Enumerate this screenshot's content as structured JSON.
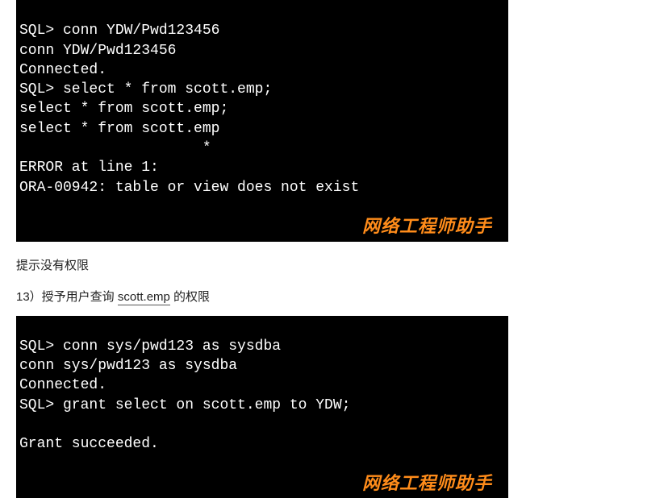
{
  "terminal1": {
    "l1": "SQL> conn YDW/Pwd123456",
    "l2": "conn YDW/Pwd123456",
    "l3": "Connected.",
    "l4": "SQL> select * from scott.emp;",
    "l5": "select * from scott.emp;",
    "l6": "select * from scott.emp",
    "l7": "                     *",
    "l8": "ERROR at line 1:",
    "l9": "ORA-00942: table or view does not exist",
    "watermark": "网络工程师助手"
  },
  "caption1": "提示没有权限",
  "step13_prefix": "13）授予用户查询 ",
  "step13_underlined": "scott.emp",
  "step13_suffix": " 的权限",
  "terminal2": {
    "l1": "SQL> conn sys/pwd123 as sysdba",
    "l2": "conn sys/pwd123 as sysdba",
    "l3": "Connected.",
    "l4": "SQL> grant select on scott.emp to YDW;",
    "l5": " ",
    "l6": "Grant succeeded.",
    "watermark": "网络工程师助手"
  }
}
